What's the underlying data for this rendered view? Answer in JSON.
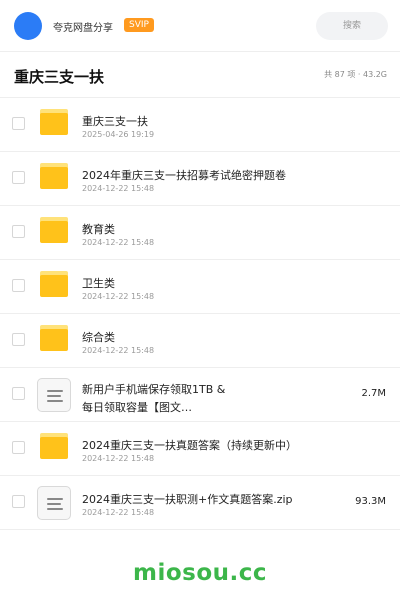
{
  "header": {
    "brand": "夸克网盘分享",
    "badge": "SVIP",
    "search_placeholder": "搜索",
    "accent": "#2b7cf6"
  },
  "folder": {
    "title": "重庆三支一扶",
    "meta": "共 87 项 · 43.2G"
  },
  "items": [
    {
      "type": "folder",
      "name": "重庆三支一扶",
      "date": "2025-04-26 19:19",
      "size": ""
    },
    {
      "type": "folder",
      "name": "2024年重庆三支一扶招募考试绝密押题卷",
      "date": "2024-12-22 15:48",
      "size": ""
    },
    {
      "type": "folder",
      "name": "教育类",
      "date": "2024-12-22 15:48",
      "size": ""
    },
    {
      "type": "folder",
      "name": "卫生类",
      "date": "2024-12-22 15:48",
      "size": ""
    },
    {
      "type": "folder",
      "name": "综合类",
      "date": "2024-12-22 15:48",
      "size": ""
    },
    {
      "type": "file",
      "name_line1": "新用户手机端保存领取1TB &",
      "name_line2": "每日领取容量【图文…",
      "date": "2024-12-22 15:48",
      "size": "2.7M"
    },
    {
      "type": "folder",
      "name": "2024重庆三支一扶真题答案（持续更新中）",
      "date": "2024-12-22 15:48",
      "size": ""
    },
    {
      "type": "file",
      "name": "2024重庆三支一扶职测+作文真题答案.zip",
      "date": "2024-12-22 15:48",
      "size": "93.3M"
    }
  ],
  "watermark": "miosou.cc"
}
